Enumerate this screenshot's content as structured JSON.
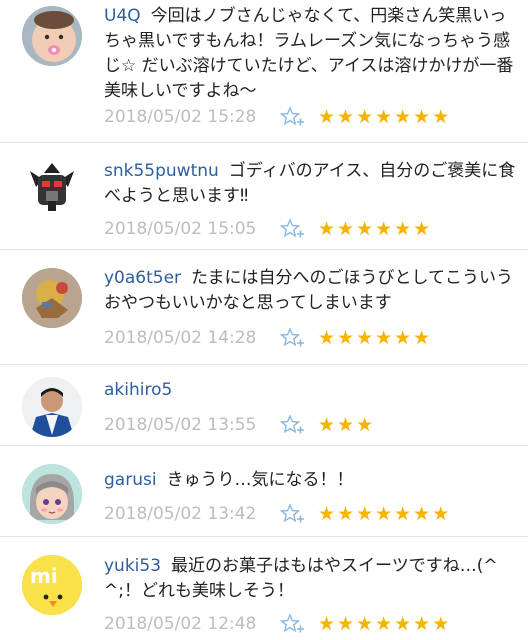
{
  "colors": {
    "username": "#2e5e9e",
    "date": "#bdbdbd",
    "star": "#f5b400",
    "star_add": "#8ab8e0",
    "divider": "#e4e4e4"
  },
  "comments": [
    {
      "username": "U4Q",
      "body": "今回はノブさんじゃなくて、円楽さん笑黒いっちゃ黒いですもんね！ラムレーズン気になっちゃう感じ☆ だいぶ溶けていたけど、アイスは溶けかけが一番美味しいですよね〜",
      "date": "2018/05/02 15:28",
      "rating": 7,
      "stars": "★★★★★★★",
      "avatar": "baby-photo"
    },
    {
      "username": "snk55puwtnu",
      "body": "ゴディバのアイス、自分のご褒美に食べようと思います‼",
      "date": "2018/05/02 15:05",
      "rating": 6,
      "stars": "★★★★★★",
      "avatar": "robot-mask"
    },
    {
      "username": "y0a6t5er",
      "body": "たまには自分へのごほうびとしてこういうおやつもいいかなと思ってしまいます",
      "date": "2018/05/02 14:28",
      "rating": 6,
      "stars": "★★★★★★",
      "avatar": "figure-photo"
    },
    {
      "username": "akihiro5",
      "body": "",
      "date": "2018/05/02 13:55",
      "rating": 3,
      "stars": "★★★",
      "avatar": "man-portrait"
    },
    {
      "username": "garusi",
      "body": "きゅうり…気になる！！",
      "date": "2018/05/02 13:42",
      "rating": 7,
      "stars": "★★★★★★★",
      "avatar": "cartoon-face"
    },
    {
      "username": "yuki53",
      "body": "最近のお菓子はもはやスイーツですね…(^^;！どれも美味しそう！",
      "date": "2018/05/02 12:48",
      "rating": 7,
      "stars": "★★★★★★★",
      "avatar": "mi-chick"
    }
  ]
}
